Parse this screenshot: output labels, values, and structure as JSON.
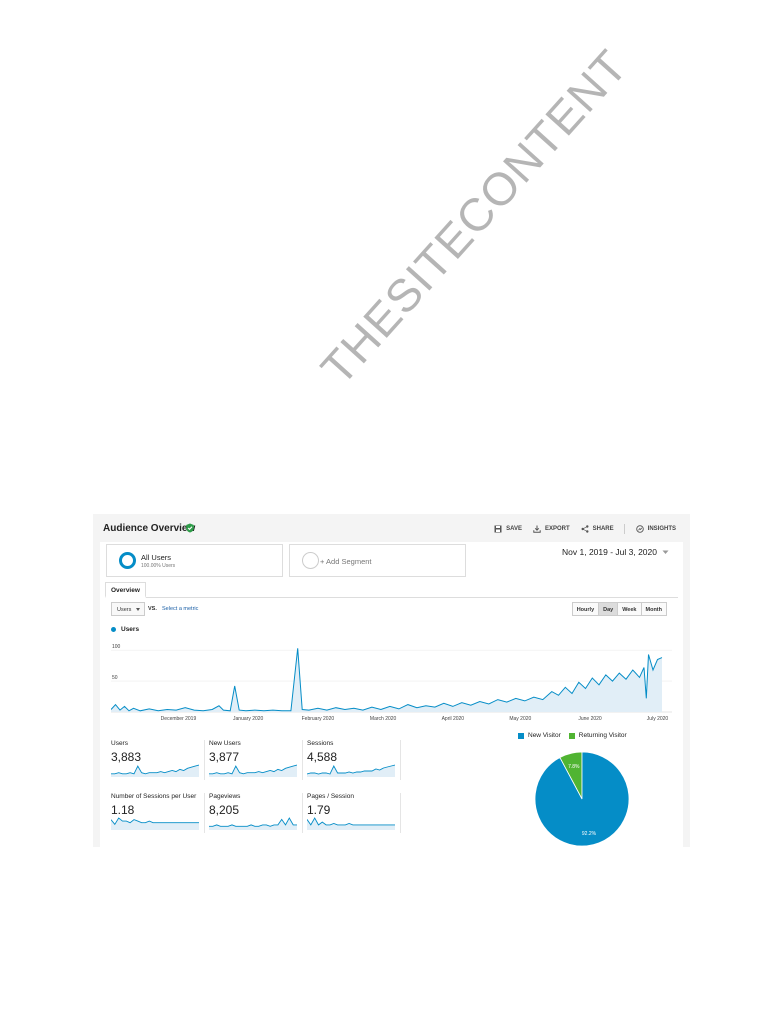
{
  "watermark": "THESITECONTENT",
  "header": {
    "title": "Audience Overview",
    "actions": [
      {
        "label": "SAVE",
        "icon": "save-icon"
      },
      {
        "label": "EXPORT",
        "icon": "export-icon"
      },
      {
        "label": "SHARE",
        "icon": "share-icon"
      },
      {
        "label": "INSIGHTS",
        "icon": "insights-icon"
      }
    ]
  },
  "segments": {
    "all_users": {
      "name": "All Users",
      "sub": "100.00% Users"
    },
    "add_segment": "+ Add Segment"
  },
  "date_range": "Nov 1, 2019 - Jul 3, 2020",
  "tabs": {
    "overview": "Overview"
  },
  "controls": {
    "metric_select": "Users",
    "vs": "VS.",
    "select_metric": "Select a metric",
    "granularity": [
      "Hourly",
      "Day",
      "Week",
      "Month"
    ],
    "granularity_active": "Day"
  },
  "colors": {
    "primary": "#058dc7",
    "secondary": "#50b432",
    "fill": "#e1eef7"
  },
  "chart_data": [
    {
      "type": "line",
      "series": [
        {
          "name": "Users"
        }
      ],
      "yticks": [
        "100",
        "50"
      ],
      "ylim": [
        0,
        110
      ],
      "xticks": [
        "December 2019",
        "January 2020",
        "February 2020",
        "March 2020",
        "April 2020",
        "May 2020",
        "June 2020",
        "July 2020"
      ],
      "x_range": [
        "2019-11-01",
        "2020-07-03"
      ],
      "points": [
        [
          "2019-11-01",
          4
        ],
        [
          "2019-11-03",
          12
        ],
        [
          "2019-11-05",
          3
        ],
        [
          "2019-11-07",
          9
        ],
        [
          "2019-11-09",
          2
        ],
        [
          "2019-11-11",
          6
        ],
        [
          "2019-11-14",
          2
        ],
        [
          "2019-11-18",
          5
        ],
        [
          "2019-11-22",
          2
        ],
        [
          "2019-11-26",
          4
        ],
        [
          "2019-11-30",
          3
        ],
        [
          "2019-12-04",
          7
        ],
        [
          "2019-12-08",
          3
        ],
        [
          "2019-12-12",
          2
        ],
        [
          "2019-12-16",
          4
        ],
        [
          "2019-12-19",
          10
        ],
        [
          "2019-12-21",
          3
        ],
        [
          "2019-12-24",
          2
        ],
        [
          "2019-12-26",
          42
        ],
        [
          "2019-12-28",
          3
        ],
        [
          "2019-12-31",
          2
        ],
        [
          "2020-01-04",
          3
        ],
        [
          "2020-01-08",
          2
        ],
        [
          "2020-01-12",
          3
        ],
        [
          "2020-01-16",
          2
        ],
        [
          "2020-01-20",
          2
        ],
        [
          "2020-01-23",
          103
        ],
        [
          "2020-01-25",
          4
        ],
        [
          "2020-01-28",
          3
        ],
        [
          "2020-02-01",
          6
        ],
        [
          "2020-02-05",
          3
        ],
        [
          "2020-02-09",
          7
        ],
        [
          "2020-02-13",
          4
        ],
        [
          "2020-02-17",
          6
        ],
        [
          "2020-02-21",
          3
        ],
        [
          "2020-02-25",
          8
        ],
        [
          "2020-02-29",
          4
        ],
        [
          "2020-03-04",
          9
        ],
        [
          "2020-03-08",
          5
        ],
        [
          "2020-03-12",
          12
        ],
        [
          "2020-03-16",
          7
        ],
        [
          "2020-03-20",
          10
        ],
        [
          "2020-03-24",
          8
        ],
        [
          "2020-03-28",
          14
        ],
        [
          "2020-04-01",
          9
        ],
        [
          "2020-04-05",
          15
        ],
        [
          "2020-04-09",
          11
        ],
        [
          "2020-04-13",
          17
        ],
        [
          "2020-04-17",
          13
        ],
        [
          "2020-04-21",
          20
        ],
        [
          "2020-04-25",
          16
        ],
        [
          "2020-04-29",
          22
        ],
        [
          "2020-05-03",
          18
        ],
        [
          "2020-05-07",
          24
        ],
        [
          "2020-05-11",
          20
        ],
        [
          "2020-05-15",
          33
        ],
        [
          "2020-05-18",
          27
        ],
        [
          "2020-05-21",
          40
        ],
        [
          "2020-05-24",
          30
        ],
        [
          "2020-05-27",
          48
        ],
        [
          "2020-05-30",
          38
        ],
        [
          "2020-06-02",
          55
        ],
        [
          "2020-06-05",
          44
        ],
        [
          "2020-06-08",
          60
        ],
        [
          "2020-06-11",
          50
        ],
        [
          "2020-06-14",
          63
        ],
        [
          "2020-06-17",
          53
        ],
        [
          "2020-06-20",
          68
        ],
        [
          "2020-06-23",
          56
        ],
        [
          "2020-06-25",
          72
        ],
        [
          "2020-06-26",
          22
        ],
        [
          "2020-06-27",
          93
        ],
        [
          "2020-06-29",
          68
        ],
        [
          "2020-07-01",
          85
        ],
        [
          "2020-07-03",
          88
        ]
      ]
    },
    {
      "type": "pie",
      "series": [
        {
          "name": "New Visitor",
          "value": 92.2,
          "label": "92.2%"
        },
        {
          "name": "Returning Visitor",
          "value": 7.8,
          "label": "7.8%"
        }
      ]
    }
  ],
  "tiles": [
    {
      "label": "Users",
      "value": "3,883",
      "spark": [
        2,
        2,
        3,
        2,
        2,
        3,
        2,
        9,
        3,
        2,
        3,
        3,
        3,
        4,
        3,
        4,
        5,
        4,
        6,
        5,
        7,
        8,
        9,
        10
      ]
    },
    {
      "label": "New Users",
      "value": "3,877",
      "spark": [
        2,
        2,
        3,
        2,
        2,
        3,
        2,
        9,
        3,
        2,
        3,
        3,
        3,
        4,
        3,
        4,
        5,
        4,
        6,
        5,
        7,
        8,
        9,
        10
      ]
    },
    {
      "label": "Sessions",
      "value": "4,588",
      "spark": [
        2,
        3,
        3,
        2,
        3,
        3,
        2,
        10,
        3,
        3,
        3,
        4,
        3,
        4,
        4,
        5,
        5,
        5,
        7,
        6,
        8,
        9,
        10,
        11
      ]
    },
    {
      "label": "Number of Sessions per User",
      "value": "1.18",
      "spark": [
        6,
        3,
        7,
        5,
        5,
        4,
        6,
        5,
        4,
        4,
        5,
        4,
        4,
        4,
        4,
        4,
        4,
        4,
        4,
        4,
        4,
        4,
        4,
        4
      ]
    },
    {
      "label": "Pageviews",
      "value": "8,205",
      "spark": [
        2,
        2,
        3,
        2,
        2,
        2,
        3,
        2,
        2,
        2,
        2,
        3,
        2,
        2,
        3,
        3,
        2,
        3,
        3,
        7,
        3,
        8,
        3,
        3
      ]
    },
    {
      "label": "Pages / Session",
      "value": "1.79",
      "spark": [
        7,
        3,
        8,
        3,
        5,
        3,
        3,
        4,
        3,
        3,
        3,
        4,
        3,
        3,
        3,
        3,
        3,
        3,
        3,
        3,
        3,
        3,
        3,
        3
      ]
    }
  ]
}
